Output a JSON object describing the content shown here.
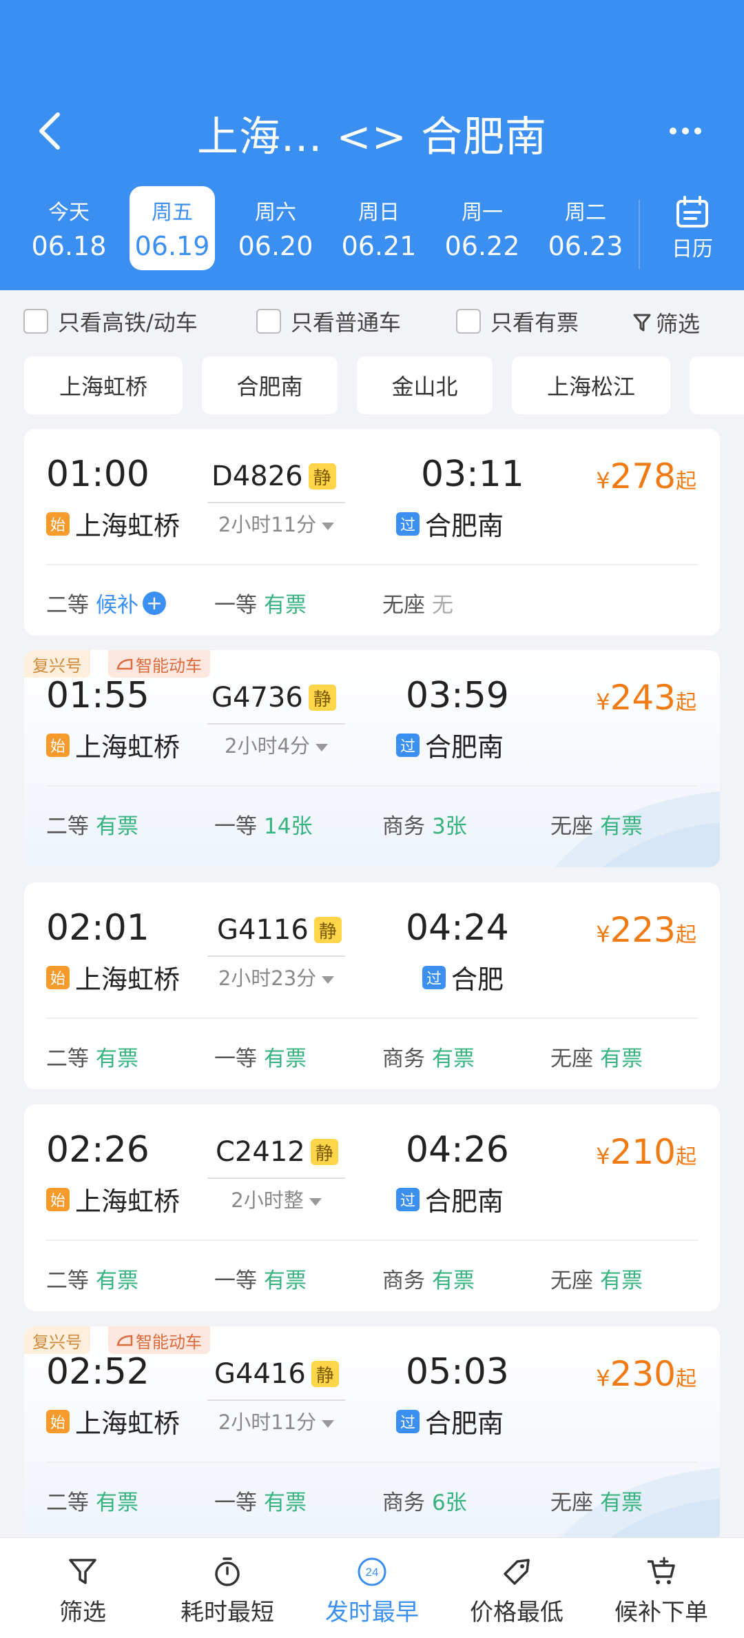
{
  "header": {
    "title": "上海... <> 合肥南",
    "dates": [
      {
        "weekday": "今天",
        "date": "06.18"
      },
      {
        "weekday": "周五",
        "date": "06.19"
      },
      {
        "weekday": "周六",
        "date": "06.20"
      },
      {
        "weekday": "周日",
        "date": "06.21"
      },
      {
        "weekday": "周一",
        "date": "06.22"
      },
      {
        "weekday": "周二",
        "date": "06.23"
      }
    ],
    "selected_date_index": 1,
    "calendar_label": "日历"
  },
  "filters": {
    "high_speed_only": "只看高铁/动车",
    "normal_only": "只看普通车",
    "available_only": "只看有票",
    "filter_label": "筛选"
  },
  "stations": [
    "上海虹桥",
    "合肥南",
    "金山北",
    "上海松江"
  ],
  "trains": [
    {
      "depart_time": "01:00",
      "train_no": "D4826",
      "quiet_badge": "静",
      "arrive_time": "03:11",
      "duration": "2小时11分",
      "from_badge": "始",
      "from": "上海虹桥",
      "to_badge": "过",
      "to": "合肥南",
      "price_symbol": "¥",
      "price": "278",
      "price_suffix": "起",
      "tags": [],
      "seats": [
        {
          "class": "二等",
          "status": "候补",
          "tone": "blue"
        },
        {
          "class": "一等",
          "status": "有票",
          "tone": "green"
        },
        {
          "class": "无座",
          "status": "无",
          "tone": "grey"
        }
      ]
    },
    {
      "depart_time": "01:55",
      "train_no": "G4736",
      "quiet_badge": "静",
      "arrive_time": "03:59",
      "duration": "2小时4分",
      "from_badge": "始",
      "from": "上海虹桥",
      "to_badge": "过",
      "to": "合肥南",
      "price_symbol": "¥",
      "price": "243",
      "price_suffix": "起",
      "tags": [
        "复兴号",
        "智能动车"
      ],
      "seats": [
        {
          "class": "二等",
          "status": "有票",
          "tone": "green"
        },
        {
          "class": "一等",
          "status": "14张",
          "tone": "green"
        },
        {
          "class": "商务",
          "status": "3张",
          "tone": "green"
        },
        {
          "class": "无座",
          "status": "有票",
          "tone": "green"
        }
      ]
    },
    {
      "depart_time": "02:01",
      "train_no": "G4116",
      "quiet_badge": "静",
      "arrive_time": "04:24",
      "duration": "2小时23分",
      "from_badge": "始",
      "from": "上海虹桥",
      "to_badge": "过",
      "to": "合肥",
      "price_symbol": "¥",
      "price": "223",
      "price_suffix": "起",
      "tags": [],
      "seats": [
        {
          "class": "二等",
          "status": "有票",
          "tone": "green"
        },
        {
          "class": "一等",
          "status": "有票",
          "tone": "green"
        },
        {
          "class": "商务",
          "status": "有票",
          "tone": "green"
        },
        {
          "class": "无座",
          "status": "有票",
          "tone": "green"
        }
      ]
    },
    {
      "depart_time": "02:26",
      "train_no": "C2412",
      "quiet_badge": "静",
      "arrive_time": "04:26",
      "duration": "2小时整",
      "from_badge": "始",
      "from": "上海虹桥",
      "to_badge": "过",
      "to": "合肥南",
      "price_symbol": "¥",
      "price": "210",
      "price_suffix": "起",
      "tags": [],
      "seats": [
        {
          "class": "二等",
          "status": "有票",
          "tone": "green"
        },
        {
          "class": "一等",
          "status": "有票",
          "tone": "green"
        },
        {
          "class": "商务",
          "status": "有票",
          "tone": "green"
        },
        {
          "class": "无座",
          "status": "有票",
          "tone": "green"
        }
      ]
    },
    {
      "depart_time": "02:52",
      "train_no": "G4416",
      "quiet_badge": "静",
      "arrive_time": "05:03",
      "duration": "2小时11分",
      "from_badge": "始",
      "from": "上海虹桥",
      "to_badge": "过",
      "to": "合肥南",
      "price_symbol": "¥",
      "price": "230",
      "price_suffix": "起",
      "tags": [
        "复兴号",
        "智能动车"
      ],
      "seats": [
        {
          "class": "二等",
          "status": "有票",
          "tone": "green"
        },
        {
          "class": "一等",
          "status": "有票",
          "tone": "green"
        },
        {
          "class": "商务",
          "status": "6张",
          "tone": "green"
        },
        {
          "class": "无座",
          "status": "有票",
          "tone": "green"
        }
      ]
    }
  ],
  "bottom_bar": [
    {
      "label": "筛选",
      "icon": "funnel-icon"
    },
    {
      "label": "耗时最短",
      "icon": "stopwatch-icon"
    },
    {
      "label": "发时最早",
      "icon": "clock-24-icon",
      "icon_text": "24",
      "active": true
    },
    {
      "label": "价格最低",
      "icon": "price-tag-icon"
    },
    {
      "label": "候补下单",
      "icon": "cart-plus-icon"
    }
  ],
  "colors": {
    "brand": "#3a8ff1",
    "price": "#f07b14",
    "available": "#36b37e",
    "quiet_badge": "#ffd54a"
  }
}
